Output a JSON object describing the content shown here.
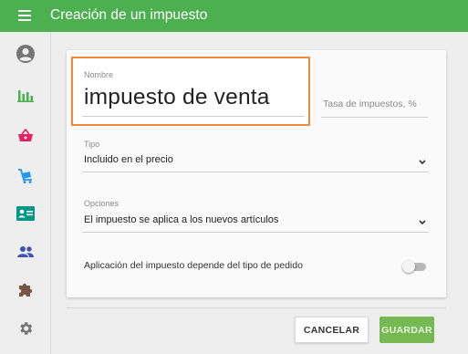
{
  "header": {
    "title": "Creación de un impuesto"
  },
  "sidebar": {
    "items": [
      {
        "name": "account-icon"
      },
      {
        "name": "reports-icon"
      },
      {
        "name": "sales-basket-icon"
      },
      {
        "name": "items-cart-icon"
      },
      {
        "name": "employees-card-icon"
      },
      {
        "name": "customers-icon"
      },
      {
        "name": "integrations-puzzle-icon"
      },
      {
        "name": "settings-gear-icon"
      }
    ]
  },
  "form": {
    "name_label": "Nombre",
    "name_value": "impuesto de venta",
    "rate_placeholder": "Tasa de impuestos, %",
    "type_label": "Tipo",
    "type_value": "Incluido en el precio",
    "options_label": "Opciones",
    "options_value": "El impuesto se aplica a los nuevos artículos",
    "toggle_label": "Aplicación del impuesto depende del tipo de pedido",
    "toggle_on": false
  },
  "actions": {
    "cancel_label": "CANCELAR",
    "save_label": "GUARDAR"
  },
  "colors": {
    "header": "#4caf50",
    "highlight": "#f0893a",
    "save": "#76b852"
  }
}
